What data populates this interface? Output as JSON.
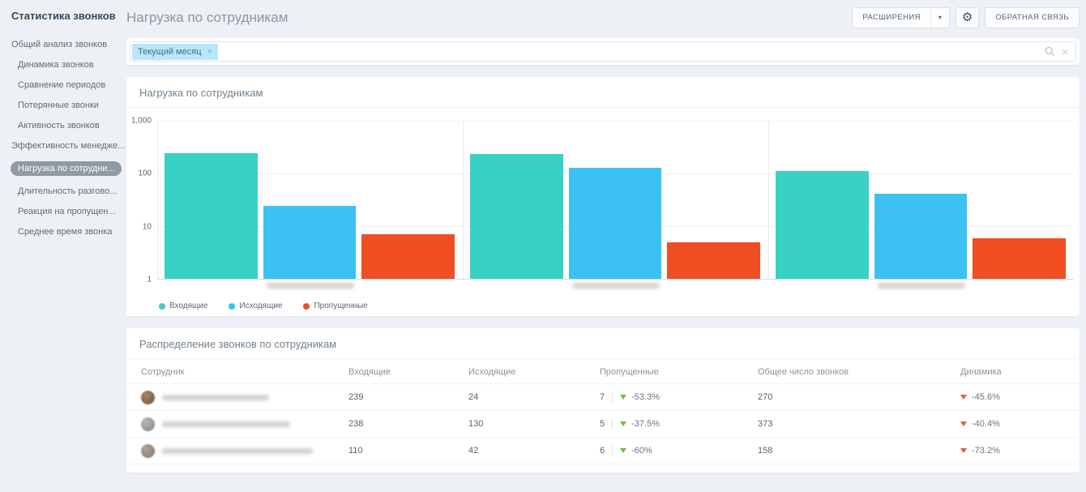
{
  "icons": {
    "caret_down": "▾",
    "gear": "⚙",
    "tag_close": "×",
    "clear": "×"
  },
  "sidebar": {
    "title": "Статистика звонков",
    "items": [
      {
        "label": "Общий анализ звонков",
        "level": 1,
        "selected": false
      },
      {
        "label": "Динамика звонков",
        "level": 2,
        "selected": false
      },
      {
        "label": "Сравнение периодов",
        "level": 2,
        "selected": false
      },
      {
        "label": "Потерянные звонки",
        "level": 2,
        "selected": false
      },
      {
        "label": "Активность звонков",
        "level": 2,
        "selected": false
      },
      {
        "label": "Эффективность менедже...",
        "level": 1,
        "selected": false
      },
      {
        "label": "Нагрузка по сотрудни...",
        "level": 2,
        "selected": true
      },
      {
        "label": "Длительность разгово...",
        "level": 2,
        "selected": false
      },
      {
        "label": "Реакция на пропущен...",
        "level": 2,
        "selected": false
      },
      {
        "label": "Среднее время звонка",
        "level": 2,
        "selected": false
      }
    ]
  },
  "header": {
    "title": "Нагрузка по сотрудникам",
    "extensions_button": "РАСШИРЕНИЯ",
    "feedback_button": "ОБРАТНАЯ СВЯЗЬ"
  },
  "filter": {
    "tag": "Текущий месяц"
  },
  "chart_panel": {
    "title": "Нагрузка по сотрудникам"
  },
  "chart_data": {
    "type": "bar",
    "title": "Нагрузка по сотрудникам",
    "y_scale": "log",
    "ylim": [
      1,
      1000
    ],
    "yticks": [
      "1,000",
      "100",
      "10",
      "1"
    ],
    "categories": [
      "",
      "",
      ""
    ],
    "categories_blurred": true,
    "grid": true,
    "legend_position": "bottom-left",
    "series": [
      {
        "name": "Входящие",
        "color": "#38d1c6",
        "values": [
          239,
          238,
          110
        ]
      },
      {
        "name": "Исходящие",
        "color": "#3bc2f3",
        "values": [
          24,
          130,
          42
        ]
      },
      {
        "name": "Пропущенные",
        "color": "#f04e23",
        "values": [
          7,
          5,
          6
        ]
      }
    ]
  },
  "table_panel": {
    "title": "Распределение звонков по сотрудникам",
    "columns": [
      "Сотрудник",
      "Входящие",
      "Исходящие",
      "Пропущенные",
      "Общее число звонков",
      "Динамика"
    ],
    "rows": [
      {
        "incoming": "239",
        "outgoing": "24",
        "missed": "7",
        "missed_change": "-53.3%",
        "missed_trend": "down",
        "total": "270",
        "dynamics": "-45.6%",
        "dynamics_trend": "down"
      },
      {
        "incoming": "238",
        "outgoing": "130",
        "missed": "5",
        "missed_change": "-37.5%",
        "missed_trend": "down",
        "total": "373",
        "dynamics": "-40.4%",
        "dynamics_trend": "down"
      },
      {
        "incoming": "110",
        "outgoing": "42",
        "missed": "6",
        "missed_change": "-60%",
        "missed_trend": "down",
        "total": "158",
        "dynamics": "-73.2%",
        "dynamics_trend": "down"
      }
    ]
  }
}
